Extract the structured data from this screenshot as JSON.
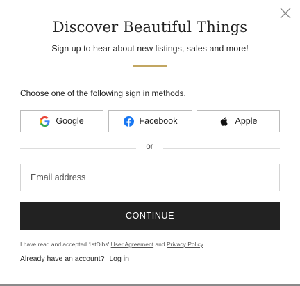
{
  "modal": {
    "title": "Discover Beautiful Things",
    "subtitle": "Sign up to hear about new listings, sales and more!",
    "close_icon": "close-icon",
    "accent_color": "#c2a661"
  },
  "signin": {
    "methods_label": "Choose one of the following sign in methods.",
    "buttons": [
      {
        "label": "Google",
        "icon": "google-icon"
      },
      {
        "label": "Facebook",
        "icon": "facebook-icon"
      },
      {
        "label": "Apple",
        "icon": "apple-icon"
      }
    ],
    "divider_text": "or"
  },
  "email": {
    "placeholder": "Email address",
    "value": ""
  },
  "continue_button": {
    "label": "CONTINUE",
    "background": "#222222"
  },
  "agreement": {
    "prefix": "I have read and accepted 1stDibs'",
    "user_agreement": "User Agreement",
    "conjunction": "and",
    "privacy_policy": "Privacy Policy"
  },
  "login": {
    "prompt": "Already have an account?",
    "link": "Log in"
  }
}
